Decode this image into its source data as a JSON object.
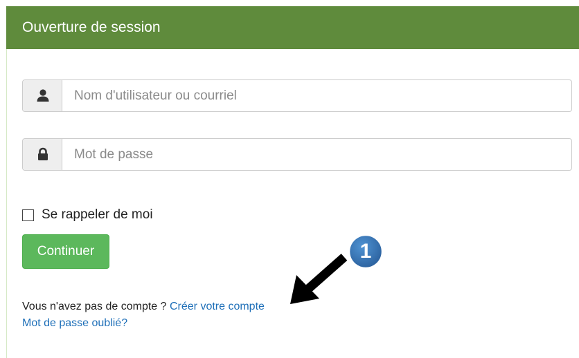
{
  "header": {
    "title": "Ouverture de session",
    "color": "#5f8b3c"
  },
  "form": {
    "username": {
      "icon": "user-icon",
      "value": "",
      "placeholder": "Nom d'utilisateur ou courriel"
    },
    "password": {
      "icon": "lock-icon",
      "value": "",
      "placeholder": "Mot de passe"
    },
    "remember": {
      "label": "Se rappeler de moi",
      "checked": false
    },
    "submit_label": "Continuer",
    "submit_color": "#5cb85c"
  },
  "links": {
    "no_account_text": "Vous n'avez pas de compte ?",
    "create_account": "Créer votre compte",
    "forgot_password": "Mot de passe oublié?",
    "link_color": "#1e6fb8"
  },
  "annotation": {
    "badge_number": "1",
    "badge_color": "#2f6fb0",
    "arrow_icon": "arrow-icon"
  }
}
